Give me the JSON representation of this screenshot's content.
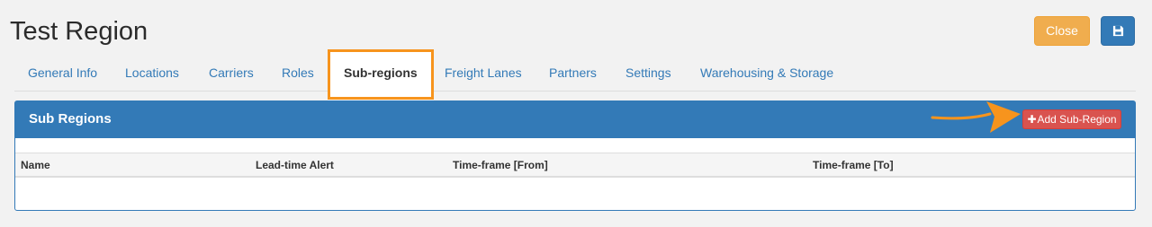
{
  "page": {
    "title": "Test Region",
    "close_label": "Close",
    "save_icon": "save-icon"
  },
  "tabs": [
    {
      "label": "General Info",
      "active": false
    },
    {
      "label": "Locations",
      "active": false
    },
    {
      "label": "Carriers",
      "active": false
    },
    {
      "label": "Roles",
      "active": false
    },
    {
      "label": "Sub-regions",
      "active": true
    },
    {
      "label": "Freight Lanes",
      "active": false
    },
    {
      "label": "Partners",
      "active": false
    },
    {
      "label": "Settings",
      "active": false
    },
    {
      "label": "Warehousing & Storage",
      "active": false
    }
  ],
  "panel": {
    "title": "Sub Regions",
    "add_button_label": "Add Sub-Region",
    "table": {
      "columns": [
        "Name",
        "Lead-time Alert",
        "Time-frame [From]",
        "Time-frame [To]"
      ],
      "rows": []
    }
  },
  "colors": {
    "primary": "#337ab7",
    "warning": "#f0ad4e",
    "danger": "#d9534f",
    "highlight": "#f7941d"
  }
}
